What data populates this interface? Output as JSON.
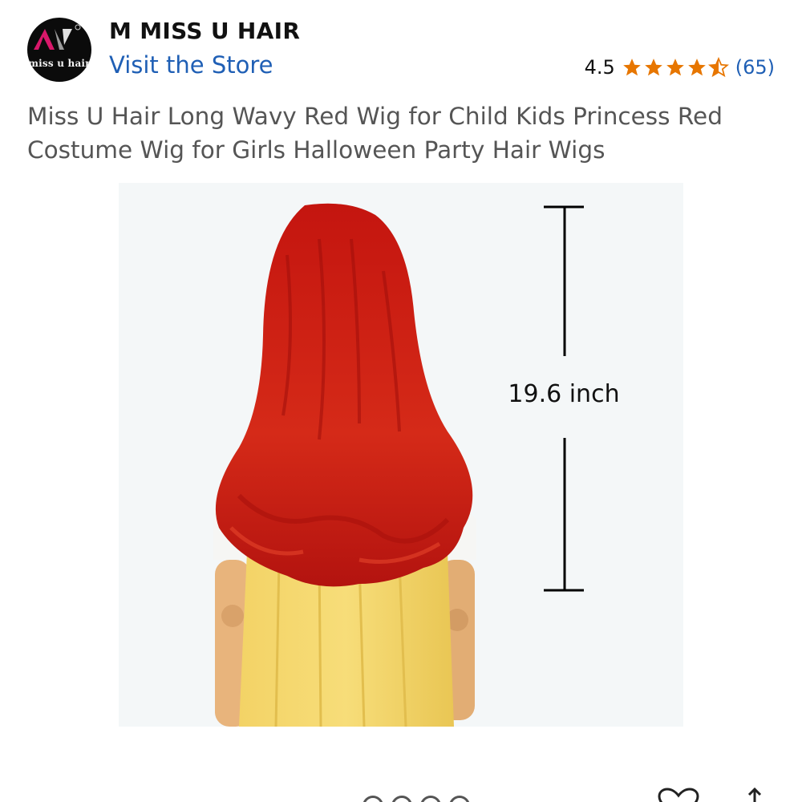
{
  "store": {
    "logo_text": "miss u hair",
    "logo_icon": "brand-logo",
    "name": "M MISS U HAIR",
    "visit_label": "Visit the Store"
  },
  "rating": {
    "value": "4.5",
    "stars": 4.5,
    "count": "(65)",
    "star_color": "#e77600"
  },
  "product": {
    "title": "Miss U Hair Long Wavy Red Wig for Child Kids Princess Red Costume Wig for Girls Halloween Party Hair Wigs",
    "image": {
      "measurement_label": "19.6 inch"
    }
  },
  "bottom_bar": {
    "icons": [
      "image-dots-indicator",
      "heart-icon",
      "share-icon"
    ]
  }
}
